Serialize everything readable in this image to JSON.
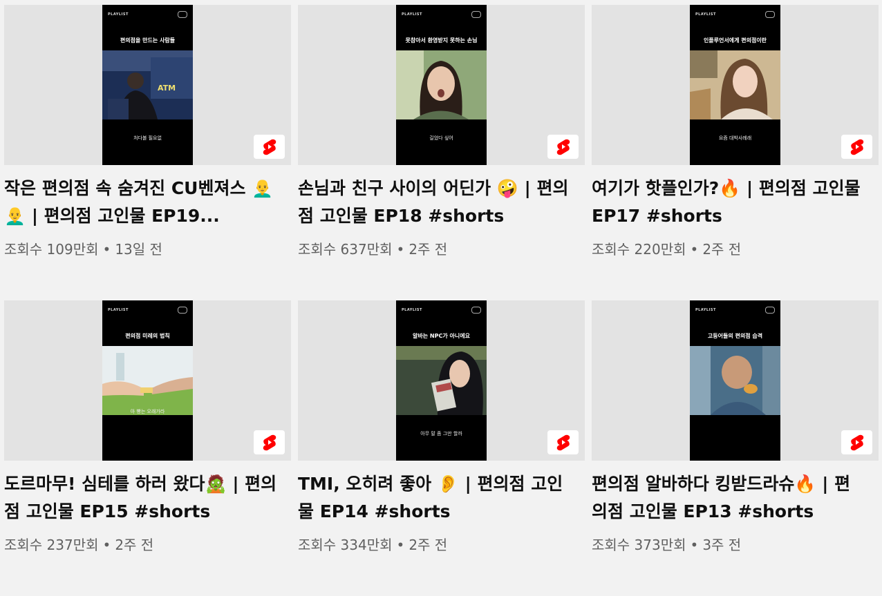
{
  "colors": {
    "background": "#f2f2f2",
    "shorts_red": "#ff0000",
    "meta_text": "#606060"
  },
  "videos": [
    {
      "title": "작은 편의점 속 숨겨진 CU벤져스 👨‍🦲👨‍🦲 | 편의점 고인물 EP19...",
      "views": "조회수 109만회",
      "age": "13일 전",
      "thumb": {
        "caption": "편의점을 만드는 사람들",
        "subtitle": "처다볼 필요없",
        "overlay": "ATM"
      },
      "badge_icon": "youtube-shorts-icon"
    },
    {
      "title": "손님과 친구 사이의 어딘가 🤪 | 편의점 고인물 EP18 #shorts",
      "views": "조회수 637만회",
      "age": "2주 전",
      "thumb": {
        "caption": "못참아서 환영받지 못하는 손님",
        "subtitle": "길었다 싶어"
      },
      "badge_icon": "youtube-shorts-icon"
    },
    {
      "title": "여기가 핫플인가?🔥 | 편의점 고인물 EP17 #shorts",
      "views": "조회수 220만회",
      "age": "2주 전",
      "thumb": {
        "caption": "인플루언서에게 편의점이란",
        "subtitle": "요즘 대박사례래"
      },
      "badge_icon": "youtube-shorts-icon"
    },
    {
      "title": "도르마무! 심테를 하러 왔다🧟 | 편의점 고인물 EP15 #shorts",
      "views": "조회수 237만회",
      "age": "2주 전",
      "thumb": {
        "caption": "편의점 미레의 법칙",
        "subtitle": "아 빵는 오래가라"
      },
      "badge_icon": "youtube-shorts-icon"
    },
    {
      "title": "TMI, 오히려 좋아 👂 | 편의점 고인물 EP14 #shorts",
      "views": "조회수 334만회",
      "age": "2주 전",
      "thumb": {
        "caption": "알바는 NPC가 아니에요",
        "subtitle": "아무 말 좀 그만 할까"
      },
      "badge_icon": "youtube-shorts-icon"
    },
    {
      "title": "편의점 알바하다 킹받드라슈🔥 | 편의점 고인물 EP13 #shorts",
      "views": "조회수 373만회",
      "age": "3주 전",
      "thumb": {
        "caption": "고등어들의 편의점 습격",
        "subtitle": ""
      },
      "badge_icon": "youtube-shorts-icon"
    }
  ],
  "playlist_label": "PLAYLIST"
}
